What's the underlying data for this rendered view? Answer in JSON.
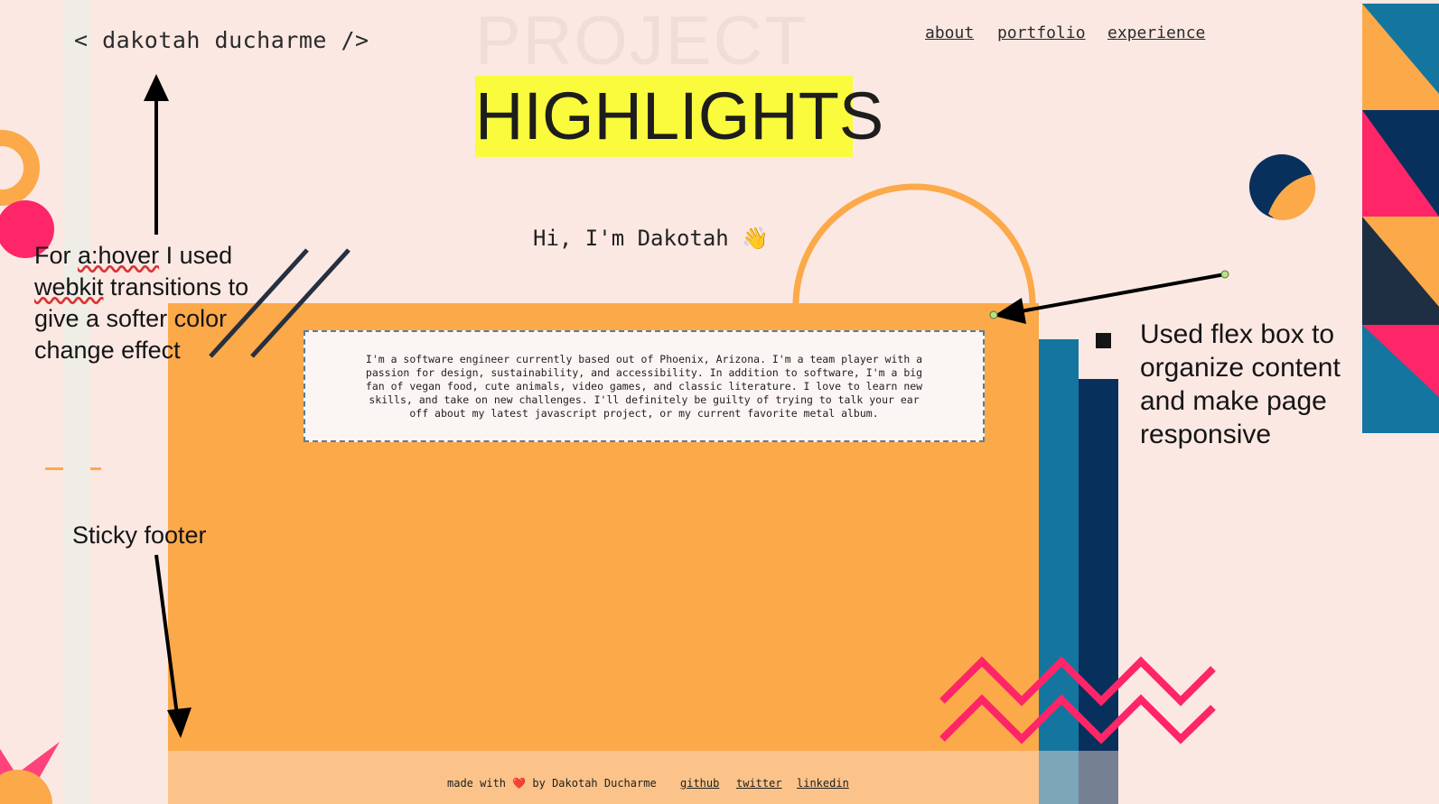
{
  "header": {
    "logo": "< dakotah ducharme />",
    "nav": [
      "about",
      "portfolio",
      "experience"
    ]
  },
  "hero": {
    "ghost_title": "PROJECT",
    "highlight_title": "HIGHLIGHTS",
    "greeting": "Hi, I'm Dakotah 👋"
  },
  "about": {
    "text": "I'm a software engineer currently based out of Phoenix, Arizona. I'm a team player with a passion for design, sustainability, and accessibility. In addition to software, I'm a big fan of vegan food, cute animals, video games, and classic literature. I love to learn new skills, and take on new challenges. I'll definitely be guilty of trying to talk your ear off about my latest javascript project, or my current favorite metal album."
  },
  "footer": {
    "credit": "made with ❤️ by Dakotah Ducharme",
    "links": [
      "github",
      "twitter",
      "linkedin"
    ]
  },
  "annotations": {
    "hover_note_prefix": "For ",
    "hover_note_keyword": "a:hover",
    "hover_note_middle": " I used ",
    "hover_note_keyword2": "webkit",
    "hover_note_suffix": " transitions to give a softer color change effect",
    "flex_note": "Used flex box to organize content and make page responsive",
    "footer_note": "Sticky footer"
  },
  "colors": {
    "background": "#fbe8e3",
    "orange": "#fca94a",
    "pink": "#fe2568",
    "teal": "#14769f",
    "navy": "#08305c",
    "highlight": "#fbfb3d"
  }
}
